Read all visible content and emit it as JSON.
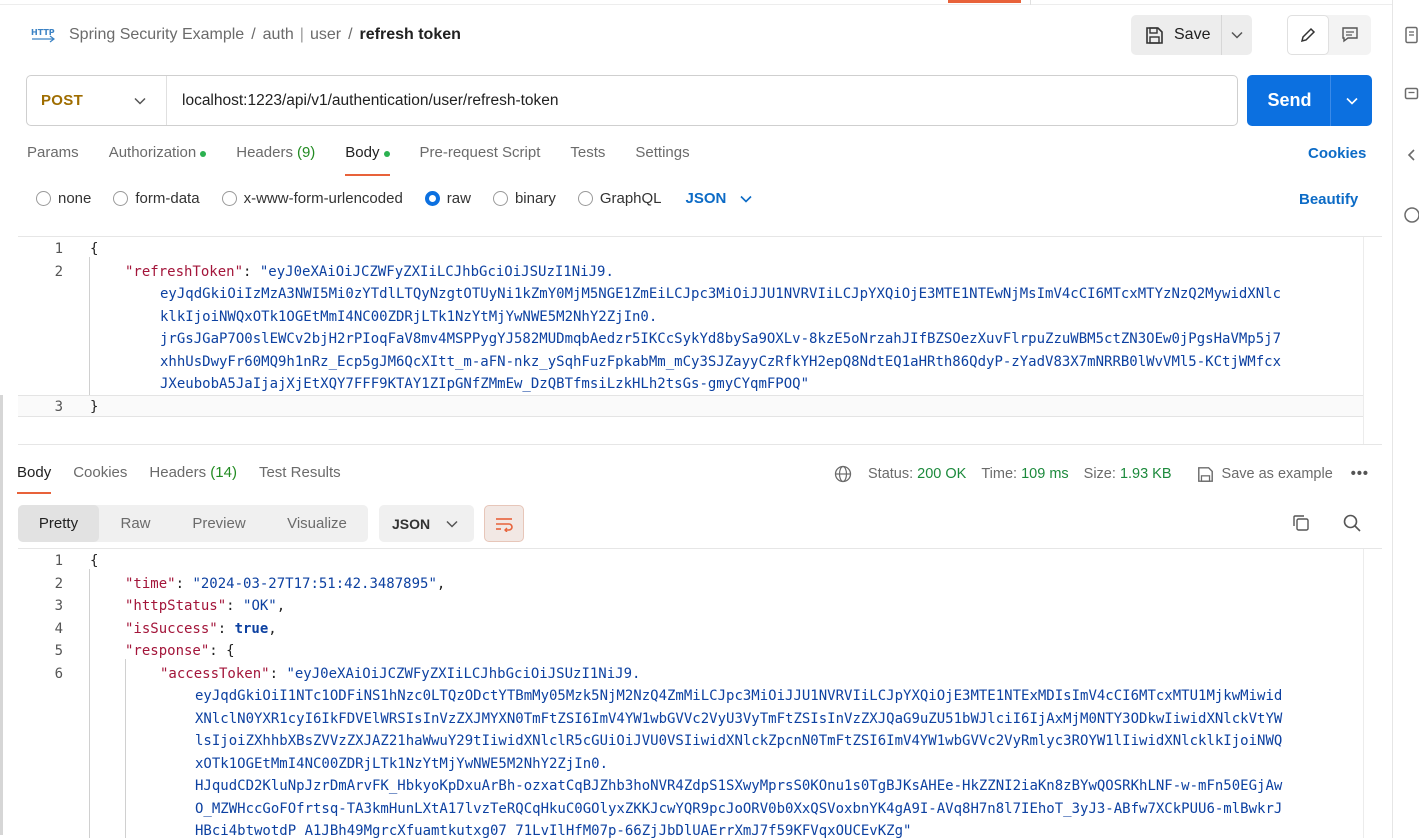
{
  "breadcrumb": {
    "items": [
      "Spring Security Example",
      "auth",
      "user"
    ],
    "current": "refresh token"
  },
  "toolbar": {
    "save_label": "Save"
  },
  "request": {
    "method": "POST",
    "url": "localhost:1223/api/v1/authentication/user/refresh-token",
    "send_label": "Send",
    "tabs": [
      {
        "label": "Params",
        "count": ""
      },
      {
        "label": "Authorization",
        "count": ""
      },
      {
        "label": "Headers",
        "count": "(9)"
      },
      {
        "label": "Body",
        "count": ""
      },
      {
        "label": "Pre-request Script",
        "count": ""
      },
      {
        "label": "Tests",
        "count": ""
      },
      {
        "label": "Settings",
        "count": ""
      }
    ],
    "cookies_label": "Cookies",
    "body_types": [
      "none",
      "form-data",
      "x-www-form-urlencoded",
      "raw",
      "binary",
      "GraphQL"
    ],
    "body_format": "JSON",
    "beautify_label": "Beautify",
    "body_lines": {
      "l1": "{",
      "l2_key": "\"refreshToken\"",
      "l2_colon": ": ",
      "l2_val_1": "\"eyJ0eXAiOiJCZWFyZXIiLCJhbGciOiJSUzI1NiJ9.",
      "l2_val_2": "eyJqdGkiOiIzMzA3NWI5Mi0zYTdlLTQyNzgtOTUyNi1kZmY0MjM5NGE1ZmEiLCJpc3MiOiJJU1NVRVIiLCJpYXQiOjE3MTE1NTEwNjMsImV4cCI6MTcxMTYzNzQ2MywidXNlc",
      "l2_val_3": "klkIjoiNWQxOTk1OGEtMmI4NC00ZDRjLTk1NzYtMjYwNWE5M2NhY2ZjIn0.",
      "l2_val_4": "jrGsJGaP7O0slEWCv2bjH2rPIoqFaV8mv4MSPPygYJ582MUDmqbAedzr5IKCcSykYd8bySa9OXLv-8kzE5oNrzahJIfBZSOezXuvFlrpuZzuWBM5ctZN3OEw0jPgsHaVMp5j7",
      "l2_val_5": "xhhUsDwyFr60MQ9h1nRz_Ecp5gJM6QcXItt_m-aFN-nkz_ySqhFuzFpkabMm_mCy3SJZayyCzRfkYH2epQ8NdtEQ1aHRth86QdyP-zYadV83X7mNRRB0lWvVMl5-KCtjWMfcx",
      "l2_val_6": "JXeubobA5JaIjajXjEtXQY7FFF9KTAY1ZIpGNfZMmEw_DzQBTfmsiLzkHLh2tsGs-gmyCYqmFPOQ\"",
      "l3": "}",
      "line_numbers": [
        "1",
        "2",
        "3"
      ]
    }
  },
  "response": {
    "tabs": [
      {
        "label": "Body",
        "count": ""
      },
      {
        "label": "Cookies",
        "count": ""
      },
      {
        "label": "Headers",
        "count": "(14)"
      },
      {
        "label": "Test Results",
        "count": ""
      }
    ],
    "status_label": "Status:",
    "status_value": "200 OK",
    "time_label": "Time:",
    "time_value": "109 ms",
    "size_label": "Size:",
    "size_value": "1.93 KB",
    "save_example_label": "Save as example",
    "views": [
      "Pretty",
      "Raw",
      "Preview",
      "Visualize"
    ],
    "format": "JSON",
    "line_numbers": [
      "1",
      "2",
      "3",
      "4",
      "5",
      "6"
    ],
    "lines": {
      "l1": "{",
      "l2_key": "\"time\"",
      "l2_val": "\"2024-03-27T17:51:42.3487895\"",
      "l3_key": "\"httpStatus\"",
      "l3_val": "\"OK\"",
      "l4_key": "\"isSuccess\"",
      "l4_val": "true",
      "l5_key": "\"response\"",
      "l5_val": "{",
      "l6_key": "\"accessToken\"",
      "l6_val_1": "\"eyJ0eXAiOiJCZWFyZXIiLCJhbGciOiJSUzI1NiJ9.",
      "l6_val_2": "eyJqdGkiOiI1NTc1ODFiNS1hNzc0LTQzODctYTBmMy05Mzk5NjM2NzQ4ZmMiLCJpc3MiOiJJU1NVRVIiLCJpYXQiOjE3MTE1NTExMDIsImV4cCI6MTcxMTU1MjkwMiwid",
      "l6_val_3": "XNlclN0YXR1cyI6IkFDVElWRSIsInVzZXJMYXN0TmFtZSI6ImV4YW1wbGVVc2VyU3VyTmFtZSIsInVzZXJQaG9uZU51bWJlciI6IjAxMjM0NTY3ODkwIiwidXNlckVtYW",
      "l6_val_4": "lsIjoiZXhhbXBsZVVzZXJAZ21haWwuY29tIiwidXNlclR5cGUiOiJVU0VSIiwidXNlckZpcnN0TmFtZSI6ImV4YW1wbGVVc2VyRmlyc3ROYW1lIiwidXNlcklkIjoiNWQ",
      "l6_val_5": "xOTk1OGEtMmI4NC00ZDRjLTk1NzYtMjYwNWE5M2NhY2ZjIn0.",
      "l6_val_6": "HJqudCD2KluNpJzrDmArvFK_HbkyoKpDxuArBh-ozxatCqBJZhb3hoNVR4ZdpS1SXwyMprsS0KOnu1s0TgBJKsAHEe-HkZZNI2iaKn8zBYwQOSRKhLNF-w-mFn50EGjAw",
      "l6_val_7": "O_MZWHccGoFOfrtsq-TA3kmHunLXtA17lvzTeRQCqHkuC0GOlyxZKKJcwYQR9pcJoORV0b0XxQSVoxbnYK4gA9I-AVq8H7n8l7IEhoT_3yJ3-ABfw7XCkPUU6-mlBwkrJ",
      "l6_val_8": "HBci4btwotdP_A1JBh49MgrcXfuamtkutxg07_71LvIlHfM07p-66ZjJbDlUAErrXmJ7f59KFVqxOUCEvKZg\""
    }
  },
  "colors": {
    "accent": "#e8623a",
    "primary": "#0c70e0",
    "method": "#9f6d00",
    "json_key": "#a3153a",
    "json_string": "#0d41a1",
    "status_ok": "#1c8a3c"
  }
}
